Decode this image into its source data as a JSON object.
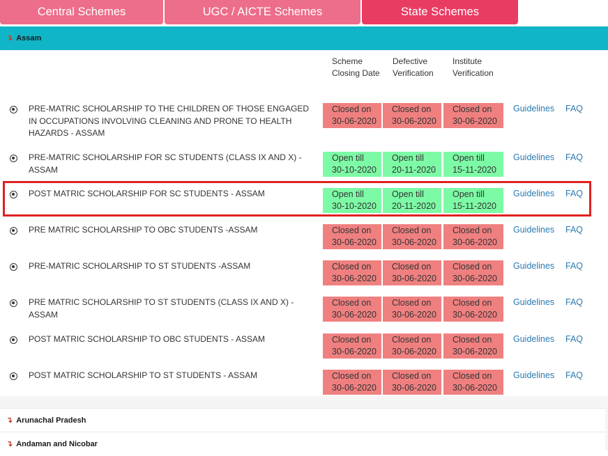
{
  "tabs": [
    {
      "label": "Central Schemes"
    },
    {
      "label": "UGC / AICTE Schemes"
    },
    {
      "label": "State Schemes"
    }
  ],
  "active_state": {
    "name": "Assam",
    "arrow": "↴"
  },
  "columns": {
    "closing_date": "Scheme Closing Date",
    "defective_verification": "Defective Verification",
    "institute_verification": "Institute Verification"
  },
  "links": {
    "guidelines": "Guidelines",
    "faq": "FAQ"
  },
  "schemes": [
    {
      "name": "PRE-MATRIC SCHOLARSHIP TO THE CHILDREN OF THOSE ENGAGED IN OCCUPATIONS INVOLVING CLEANING AND PRONE TO HEALTH HAZARDS - ASSAM",
      "closing": {
        "label": "Closed on",
        "date": "30-06-2020",
        "status": "closed"
      },
      "defective": {
        "label": "Closed on",
        "date": "30-06-2020",
        "status": "closed"
      },
      "institute": {
        "label": "Closed on",
        "date": "30-06-2020",
        "status": "closed"
      }
    },
    {
      "name": "PRE-MATRIC SCHOLARSHIP FOR SC STUDENTS (CLASS IX AND X) - ASSAM",
      "closing": {
        "label": "Open till",
        "date": "30-10-2020",
        "status": "open"
      },
      "defective": {
        "label": "Open till",
        "date": "20-11-2020",
        "status": "open"
      },
      "institute": {
        "label": "Open till",
        "date": "15-11-2020",
        "status": "open"
      }
    },
    {
      "name": "POST MATRIC SCHOLARSHIP FOR SC STUDENTS - ASSAM",
      "closing": {
        "label": "Open till",
        "date": "30-10-2020",
        "status": "open"
      },
      "defective": {
        "label": "Open till",
        "date": "20-11-2020",
        "status": "open"
      },
      "institute": {
        "label": "Open till",
        "date": "15-11-2020",
        "status": "open"
      }
    },
    {
      "name": "PRE MATRIC SCHOLARSHIP TO OBC STUDENTS -ASSAM",
      "closing": {
        "label": "Closed on",
        "date": "30-06-2020",
        "status": "closed"
      },
      "defective": {
        "label": "Closed on",
        "date": "30-06-2020",
        "status": "closed"
      },
      "institute": {
        "label": "Closed on",
        "date": "30-06-2020",
        "status": "closed"
      }
    },
    {
      "name": "PRE-MATRIC SCHOLARSHIP TO ST STUDENTS -ASSAM",
      "closing": {
        "label": "Closed on",
        "date": "30-06-2020",
        "status": "closed"
      },
      "defective": {
        "label": "Closed on",
        "date": "30-06-2020",
        "status": "closed"
      },
      "institute": {
        "label": "Closed on",
        "date": "30-06-2020",
        "status": "closed"
      }
    },
    {
      "name": "PRE MATRIC SCHOLARSHIP TO ST STUDENTS (CLASS IX AND X) - ASSAM",
      "closing": {
        "label": "Closed on",
        "date": "30-06-2020",
        "status": "closed"
      },
      "defective": {
        "label": "Closed on",
        "date": "30-06-2020",
        "status": "closed"
      },
      "institute": {
        "label": "Closed on",
        "date": "30-06-2020",
        "status": "closed"
      }
    },
    {
      "name": "POST MATRIC SCHOLARSHIP TO OBC STUDENTS - ASSAM",
      "closing": {
        "label": "Closed on",
        "date": "30-06-2020",
        "status": "closed"
      },
      "defective": {
        "label": "Closed on",
        "date": "30-06-2020",
        "status": "closed"
      },
      "institute": {
        "label": "Closed on",
        "date": "30-06-2020",
        "status": "closed"
      }
    },
    {
      "name": "POST MATRIC SCHOLARSHIP TO ST STUDENTS - ASSAM",
      "closing": {
        "label": "Closed on",
        "date": "30-06-2020",
        "status": "closed"
      },
      "defective": {
        "label": "Closed on",
        "date": "30-06-2020",
        "status": "closed"
      },
      "institute": {
        "label": "Closed on",
        "date": "30-06-2020",
        "status": "closed"
      }
    }
  ],
  "other_states": [
    {
      "name": "Arunachal Pradesh",
      "arrow": "↴"
    },
    {
      "name": "Andaman and Nicobar",
      "arrow": "↴"
    }
  ],
  "colors": {
    "tab": "#ed6e8a",
    "tab_active": "#e93c63",
    "state_header": "#10b5c7",
    "closed": "#f08080",
    "open": "#7dfaa5",
    "link": "#2a7ab0",
    "highlight": "#e0201f"
  }
}
